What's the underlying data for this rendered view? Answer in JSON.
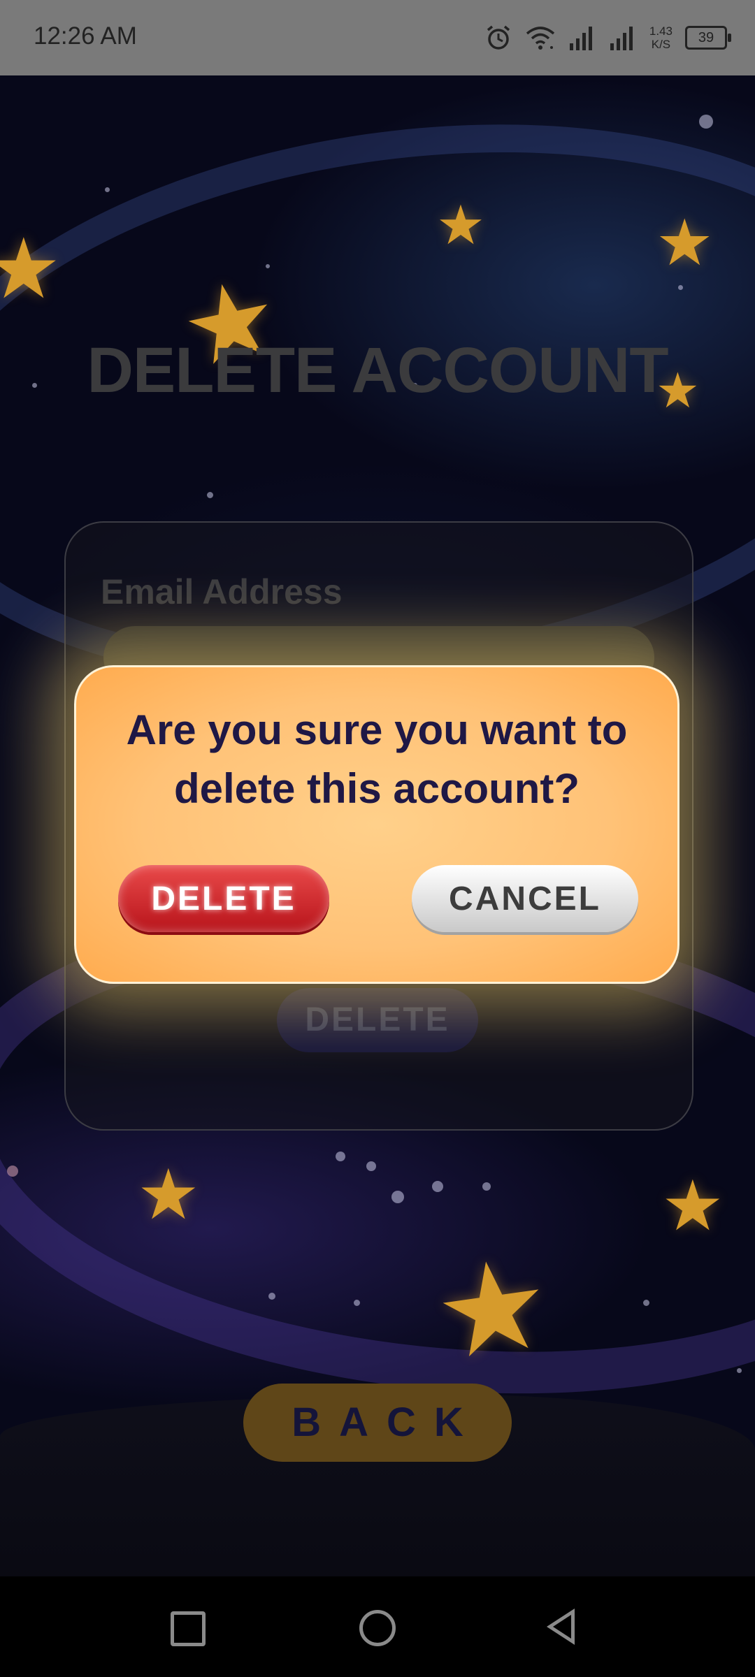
{
  "status_bar": {
    "time": "12:26 AM",
    "speed_value": "1.43",
    "speed_unit": "K/S",
    "battery": "39"
  },
  "page": {
    "title": "DELETE ACCOUNT",
    "email_label": "Email Address",
    "email_value": "",
    "delete_label": "DELETE",
    "back_label": "BACK"
  },
  "dialog": {
    "message": "Are you sure you want to delete this account?",
    "delete_label": "DELETE",
    "cancel_label": "CANCEL",
    "colors": {
      "delete": "#d42a2f",
      "cancel": "#e6e6e6",
      "panel": "#ffc277",
      "text": "#1f1845"
    }
  },
  "icons": [
    "alarm-icon",
    "wifi-icon",
    "signal-icon",
    "battery-icon",
    "nav-recent-icon",
    "nav-home-icon",
    "nav-back-icon"
  ]
}
